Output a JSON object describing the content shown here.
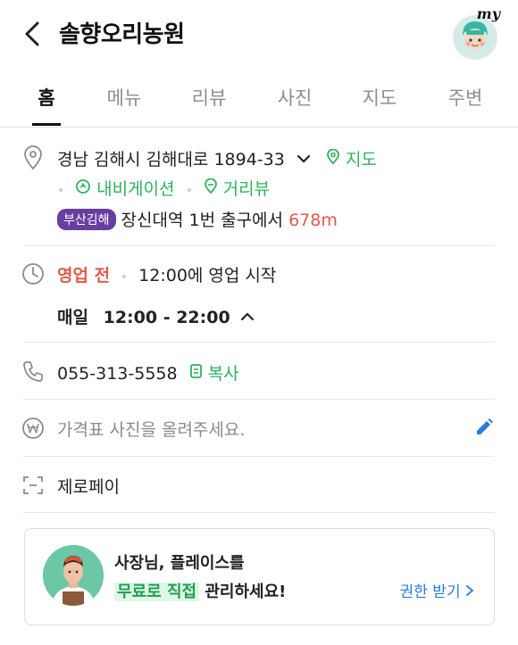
{
  "header": {
    "title": "솔향오리농원",
    "my_label": "my"
  },
  "tabs": [
    "홈",
    "메뉴",
    "리뷰",
    "사진",
    "지도",
    "주변"
  ],
  "address": {
    "text": "경남 김해시 김해대로 1894-33",
    "map_label": "지도",
    "navigation_label": "내비게이션",
    "streetview_label": "거리뷰",
    "subway_badge": "부산김해",
    "subway_text": "장신대역 1번 출구에서",
    "distance": "678m"
  },
  "hours": {
    "status": "영업 전",
    "open_info": "12:00에 영업 시작",
    "schedule_day": "매일",
    "schedule_time": "12:00 - 22:00"
  },
  "phone": {
    "number": "055-313-5558",
    "copy_label": "복사"
  },
  "price": {
    "placeholder": "가격표 사진을 올려주세요."
  },
  "pay": {
    "label": "제로페이"
  },
  "owner_card": {
    "line1": "사장님, 플레이스를",
    "highlight": "무료로 직접",
    "line2_rest": "관리하세요!",
    "link": "권한 받기"
  },
  "colors": {
    "accent_green": "#2db35c",
    "status_red": "#e05a4a",
    "link_blue": "#2b7be0",
    "badge_purple": "#6a3da0"
  }
}
